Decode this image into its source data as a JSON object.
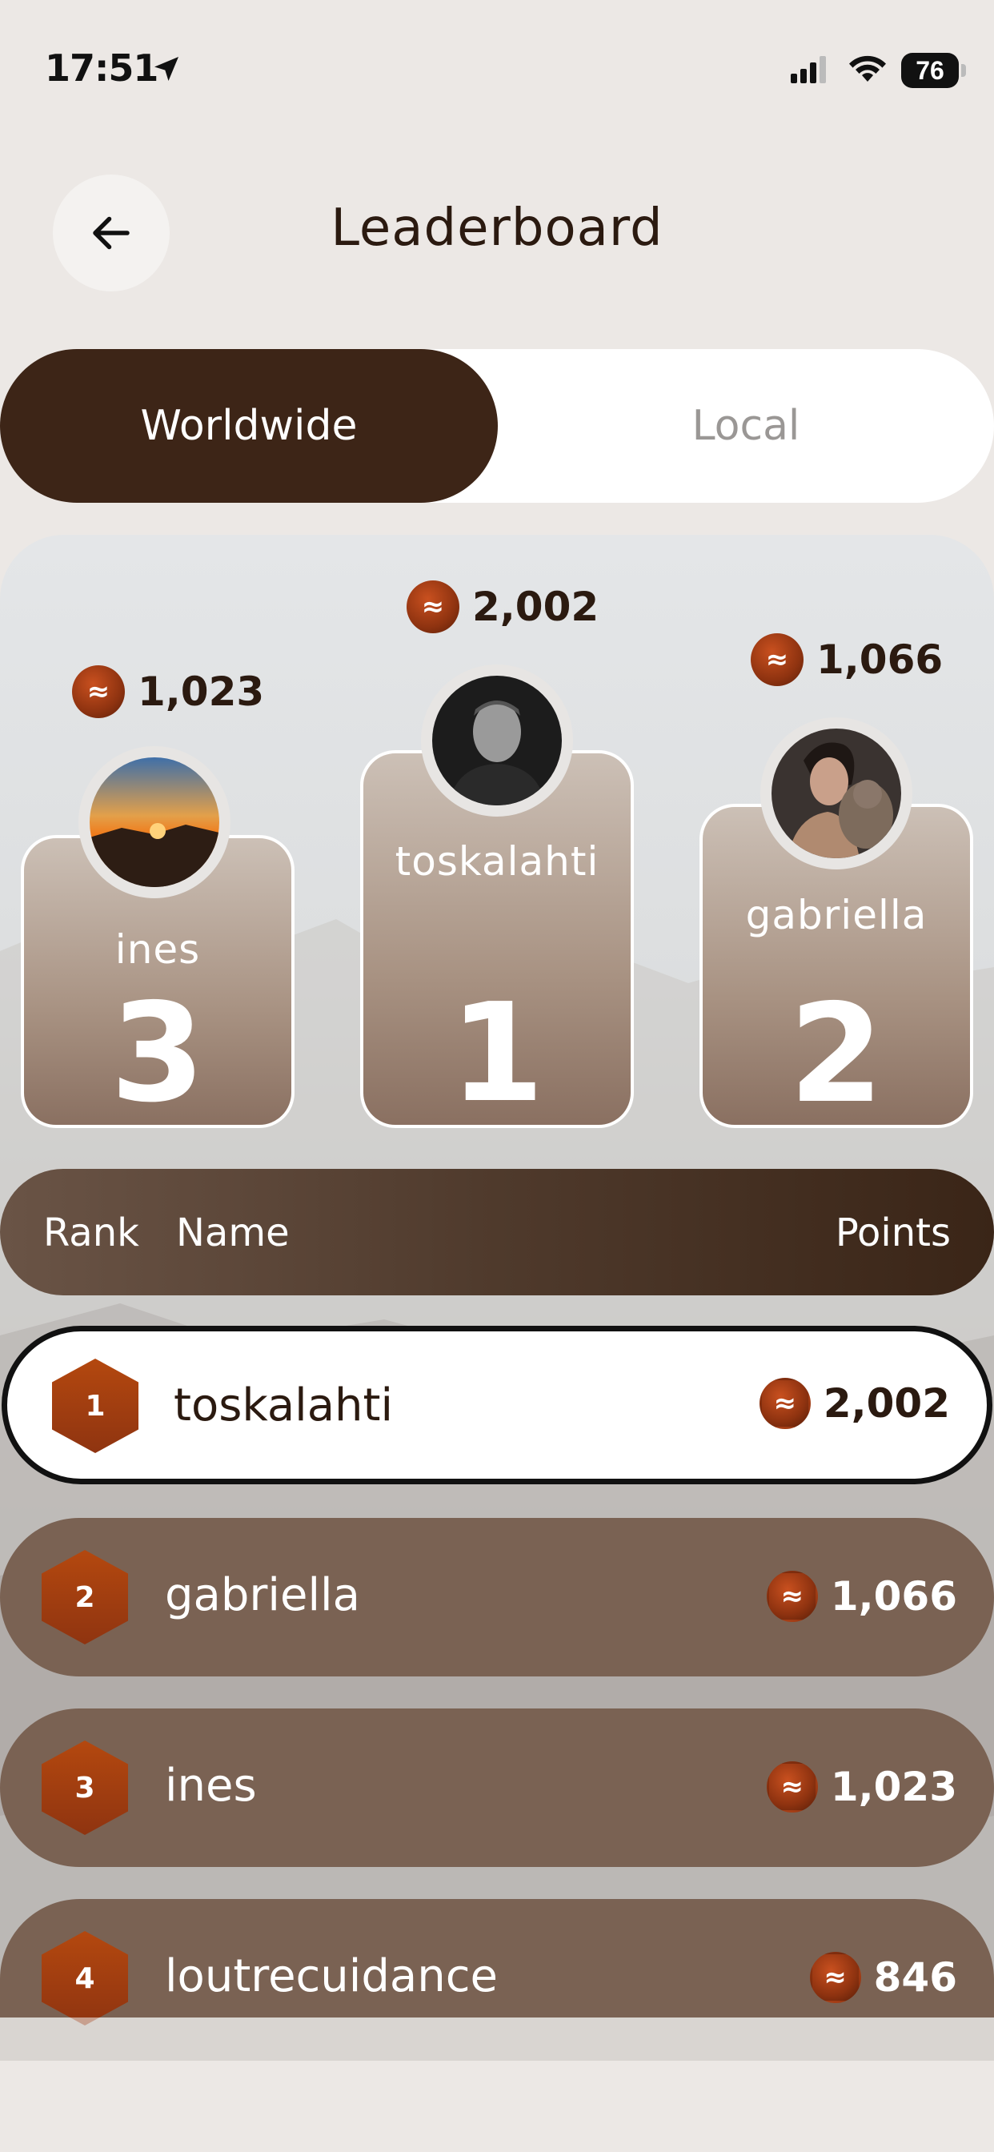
{
  "status_bar": {
    "time": "17:51",
    "battery": "76"
  },
  "header": {
    "title": "Leaderboard"
  },
  "tabs": {
    "worldwide": "Worldwide",
    "local": "Local"
  },
  "podium": [
    {
      "place": "3",
      "name": "ines",
      "points": "1,023"
    },
    {
      "place": "1",
      "name": "toskalahti",
      "points": "2,002"
    },
    {
      "place": "2",
      "name": "gabriella",
      "points": "1,066"
    }
  ],
  "table": {
    "headers": {
      "rank": "Rank",
      "name": "Name",
      "points": "Points"
    },
    "rows": [
      {
        "rank": "1",
        "name": "toskalahti",
        "points": "2,002",
        "highlighted": true
      },
      {
        "rank": "2",
        "name": "gabriella",
        "points": "1,066"
      },
      {
        "rank": "3",
        "name": "ines",
        "points": "1,023"
      },
      {
        "rank": "4",
        "name": "loutrecuidance",
        "points": "846"
      }
    ]
  },
  "coin_symbol": "≈",
  "colors": {
    "brand_dark": "#3d2517",
    "row_bg": "#7a6253",
    "coin": "#8f3310"
  }
}
